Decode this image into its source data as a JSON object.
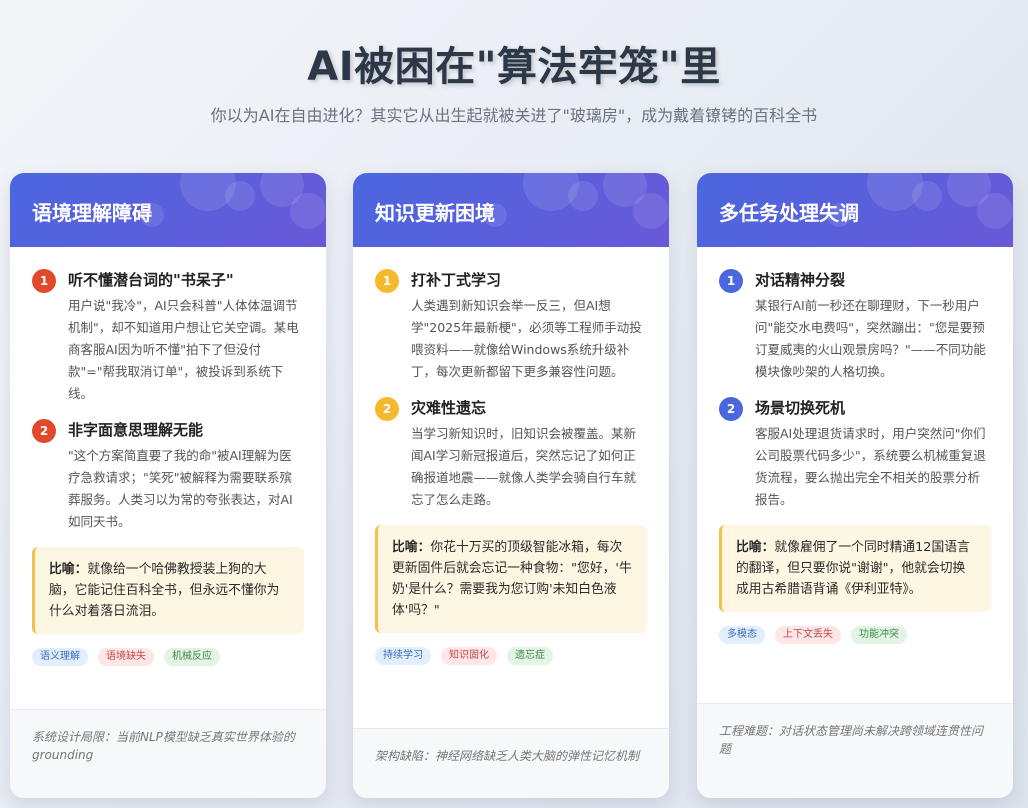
{
  "header": {
    "title": "AI被困在\"算法牢笼\"里",
    "subtitle": "你以为AI在自由进化？其实它从出生起就被关进了\"玻璃房\"，成为戴着镣铐的百科全书"
  },
  "colors": {
    "header_gradient_start": "#4a67e0",
    "header_gradient_end": "#6a58d8",
    "num_red": "#e04a2a",
    "num_yellow": "#f5b92e",
    "num_blue": "#4a67e0",
    "analogy_bg": "#fdf6e2",
    "analogy_border": "#f3c04a"
  },
  "cards": [
    {
      "title": "语境理解障碍",
      "items": [
        {
          "num": "1",
          "title": "听不懂潜台词的\"书呆子\"",
          "desc": "用户说\"我冷\"，AI只会科普\"人体体温调节机制\"，却不知道用户想让它关空调。某电商客服AI因为听不懂\"拍下了但没付款\"=\"帮我取消订单\"，被投诉到系统下线。"
        },
        {
          "num": "2",
          "title": "非字面意思理解无能",
          "desc": "\"这个方案简直要了我的命\"被AI理解为医疗急救请求；\"笑死\"被解释为需要联系殡葬服务。人类习以为常的夸张表达，对AI如同天书。"
        }
      ],
      "analogy_label": "比喻：",
      "analogy": "就像给一个哈佛教授装上狗的大脑，它能记住百科全书，但永远不懂你为什么对着落日流泪。",
      "tags": [
        "语义理解",
        "语境缺失",
        "机械反应"
      ],
      "footer": "系统设计局限：当前NLP模型缺乏真实世界体验的grounding"
    },
    {
      "title": "知识更新困境",
      "items": [
        {
          "num": "1",
          "title": "打补丁式学习",
          "desc": "人类遇到新知识会举一反三，但AI想学\"2025年最新梗\"，必须等工程师手动投喂资料——就像给Windows系统升级补丁，每次更新都留下更多兼容性问题。"
        },
        {
          "num": "2",
          "title": "灾难性遗忘",
          "desc": "当学习新知识时，旧知识会被覆盖。某新闻AI学习新冠报道后，突然忘记了如何正确报道地震——就像人类学会骑自行车就忘了怎么走路。"
        }
      ],
      "analogy_label": "比喻：",
      "analogy": "你花十万买的顶级智能冰箱，每次更新固件后就会忘记一种食物：\"您好，'牛奶'是什么？需要我为您订购'未知白色液体'吗？\"",
      "tags": [
        "持续学习",
        "知识固化",
        "遗忘症"
      ],
      "footer": "架构缺陷：神经网络缺乏人类大脑的弹性记忆机制"
    },
    {
      "title": "多任务处理失调",
      "items": [
        {
          "num": "1",
          "title": "对话精神分裂",
          "desc": "某银行AI前一秒还在聊理财，下一秒用户问\"能交水电费吗\"，突然蹦出：\"您是要预订夏威夷的火山观景房吗？\"——不同功能模块像吵架的人格切换。"
        },
        {
          "num": "2",
          "title": "场景切换死机",
          "desc": "客服AI处理退货请求时，用户突然问\"你们公司股票代码多少\"，系统要么机械重复退货流程，要么抛出完全不相关的股票分析报告。"
        }
      ],
      "analogy_label": "比喻：",
      "analogy": "就像雇佣了一个同时精通12国语言的翻译，但只要你说\"谢谢\"，他就会切换成用古希腊语背诵《伊利亚特》。",
      "tags": [
        "多模态",
        "上下文丢失",
        "功能冲突"
      ],
      "footer": "工程难题：对话状态管理尚未解决跨领域连贯性问题"
    }
  ]
}
